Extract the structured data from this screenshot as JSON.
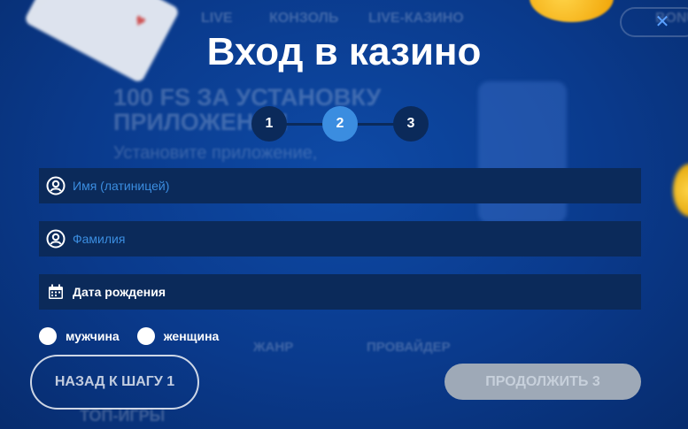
{
  "background": {
    "nav": [
      "LIVE",
      "КОНЗОЛЬ",
      "LIVE-КАЗИНО",
      "BONUS"
    ],
    "promo_title_1": "100 FS ЗА УСТАНОВКУ",
    "promo_title_2": "ПРИЛОЖЕНИЯ",
    "promo_sub": "Установите приложение,",
    "filters": [
      "ЖАНР",
      "ПРОВАЙДЕР"
    ],
    "top_games": "ТОП-ИГРЫ"
  },
  "modal": {
    "title": "Вход в казино",
    "close_glyph": "✕",
    "steps": [
      "1",
      "2",
      "3"
    ],
    "active_step": 2,
    "fields": {
      "first_name_placeholder": "Имя (латиницей)",
      "last_name_placeholder": "Фамилия",
      "birth_date_label": "Дата рождения"
    },
    "gender": {
      "male": "мужчина",
      "female": "женщина"
    },
    "back_button": "НАЗАД К ШАГУ 1",
    "next_button": "ПРОДОЛЖИТЬ 3"
  },
  "colors": {
    "accent": "#3b8de0",
    "field_bg": "#0b2a5a",
    "page_bg": "#0a3a8c",
    "disabled_button": "#9ea9b7"
  },
  "icons": {
    "first_name": "user-circle-icon",
    "last_name": "user-circle-icon",
    "birth_date": "calendar-icon",
    "close": "close-icon"
  }
}
